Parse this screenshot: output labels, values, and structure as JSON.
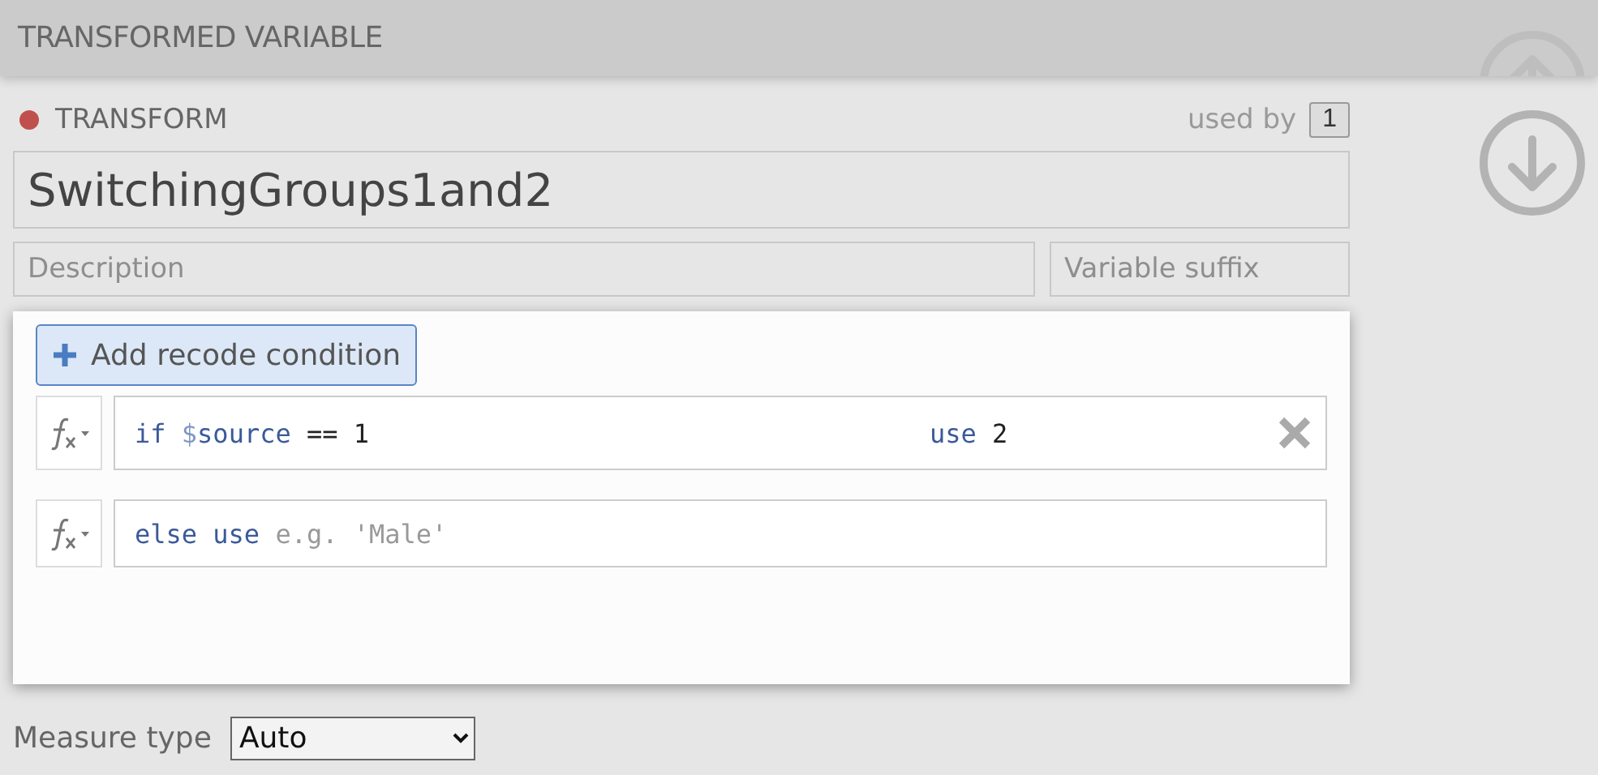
{
  "header": {
    "title": "TRANSFORMED VARIABLE"
  },
  "transform": {
    "label": "TRANSFORM",
    "used_by_label": "used by",
    "used_by_count": "1"
  },
  "name_field": {
    "value": "SwitchingGroups1and2"
  },
  "description_field": {
    "placeholder": "Description"
  },
  "suffix_field": {
    "placeholder": "Variable suffix"
  },
  "recode": {
    "add_button": "Add recode condition",
    "conditions": [
      {
        "kind": "if",
        "tokens": [
          {
            "kind": "keyword",
            "text": "if "
          },
          {
            "kind": "sigil",
            "text": "$"
          },
          {
            "kind": "keyword",
            "text": "source"
          },
          {
            "kind": "plain",
            "text": " == 1"
          }
        ],
        "result": [
          {
            "kind": "keyword",
            "text": "use"
          },
          {
            "kind": "plain",
            "text": " 2"
          }
        ],
        "removable": true
      },
      {
        "kind": "else",
        "tokens": [
          {
            "kind": "keyword",
            "text": "else use"
          },
          {
            "kind": "placeholder",
            "text": " e.g. 'Male'"
          }
        ],
        "removable": false
      }
    ]
  },
  "measure_type": {
    "label": "Measure type",
    "value": "Auto"
  }
}
